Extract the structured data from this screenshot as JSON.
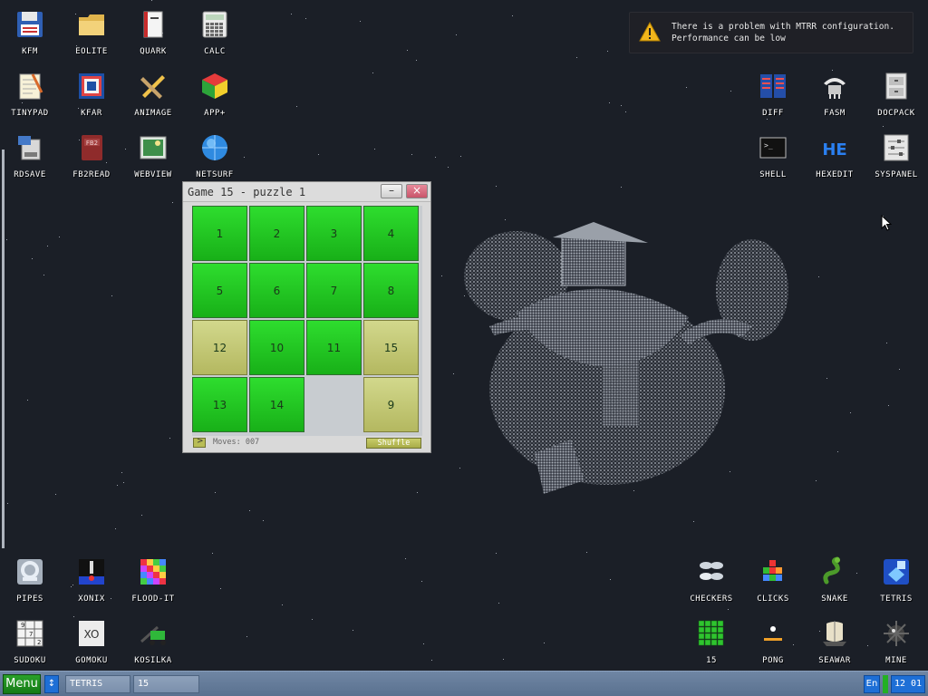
{
  "desktop": {
    "icons_top_left": [
      {
        "label": "KFM",
        "icon": "floppy-disk-icon"
      },
      {
        "label": "EOLITE",
        "icon": "folder-icon"
      },
      {
        "label": "QUARK",
        "icon": "book-icon"
      },
      {
        "label": "CALC",
        "icon": "calculator-icon"
      },
      {
        "label": "TINYPAD",
        "icon": "notepad-icon"
      },
      {
        "label": "KFAR",
        "icon": "archive-icon"
      },
      {
        "label": "ANIMAGE",
        "icon": "pencil-ruler-icon"
      },
      {
        "label": "APP+",
        "icon": "cube-icon"
      },
      {
        "label": "RDSAVE",
        "icon": "ram-disk-icon"
      },
      {
        "label": "FB2READ",
        "icon": "fb2-book-icon"
      },
      {
        "label": "WEBVIEW",
        "icon": "web-image-icon"
      },
      {
        "label": "NETSURF",
        "icon": "globe-icon"
      }
    ],
    "icons_top_right": [
      {
        "label": "DIFF",
        "icon": "diff-icon"
      },
      {
        "label": "FASM",
        "icon": "fasm-icon"
      },
      {
        "label": "DOCPACK",
        "icon": "cabinet-icon"
      },
      {
        "label": "SHELL",
        "icon": "terminal-icon"
      },
      {
        "label": "HEXEDIT",
        "icon": "hex-icon"
      },
      {
        "label": "SYSPANEL",
        "icon": "sliders-icon"
      }
    ],
    "icons_bottom_left": [
      {
        "label": "PIPES",
        "icon": "pipes-icon"
      },
      {
        "label": "XONIX",
        "icon": "xonix-icon"
      },
      {
        "label": "FLOOD-IT",
        "icon": "color-grid-icon"
      },
      {
        "label": "SUDOKU",
        "icon": "sudoku-icon"
      },
      {
        "label": "GOMOKU",
        "icon": "gomoku-icon"
      },
      {
        "label": "KOSILKA",
        "icon": "lawnmower-icon"
      }
    ],
    "icons_bottom_right": [
      {
        "label": "CHECKERS",
        "icon": "checkers-icon"
      },
      {
        "label": "CLICKS",
        "icon": "clicks-icon"
      },
      {
        "label": "SNAKE",
        "icon": "snake-icon"
      },
      {
        "label": "TETRIS",
        "icon": "tetris-icon"
      },
      {
        "label": "15",
        "icon": "fifteen-icon"
      },
      {
        "label": "PONG",
        "icon": "pong-icon"
      },
      {
        "label": "SEAWAR",
        "icon": "seawar-icon"
      },
      {
        "label": "MINE",
        "icon": "mine-icon"
      }
    ]
  },
  "notification": {
    "line1": "There is a problem with MTRR configuration.",
    "line2": "Performance can be low"
  },
  "game_window": {
    "title": "Game 15 - puzzle 1",
    "minimize_label": "–",
    "close_label": "×",
    "tiles": [
      [
        "1",
        "2",
        "3",
        "4"
      ],
      [
        "5",
        "6",
        "7",
        "8"
      ],
      [
        "12",
        "10",
        "11",
        "15"
      ],
      [
        "13",
        "14",
        "",
        "9"
      ]
    ],
    "tile_styles": [
      [
        "green",
        "green",
        "green",
        "green"
      ],
      [
        "green",
        "green",
        "green",
        "green"
      ],
      [
        "olive",
        "green",
        "green",
        "olive"
      ],
      [
        "green",
        "green",
        "empty",
        "olive"
      ]
    ],
    "moves_text": "Moves: 007",
    "shuffle_label": "Shuffle",
    "arrow_label": ">"
  },
  "taskbar": {
    "menu_label": "Menu",
    "arrow_label": "↕",
    "tasks": [
      "TETRIS",
      "15"
    ],
    "lang": "En",
    "clock": "12 01"
  },
  "colors": {
    "tile_green": "#22c822",
    "tile_olive": "#c4c874",
    "desktop_bg": "#1b1f27",
    "taskbar": "#6a80a0",
    "menu_green": "#1e8f1e"
  }
}
